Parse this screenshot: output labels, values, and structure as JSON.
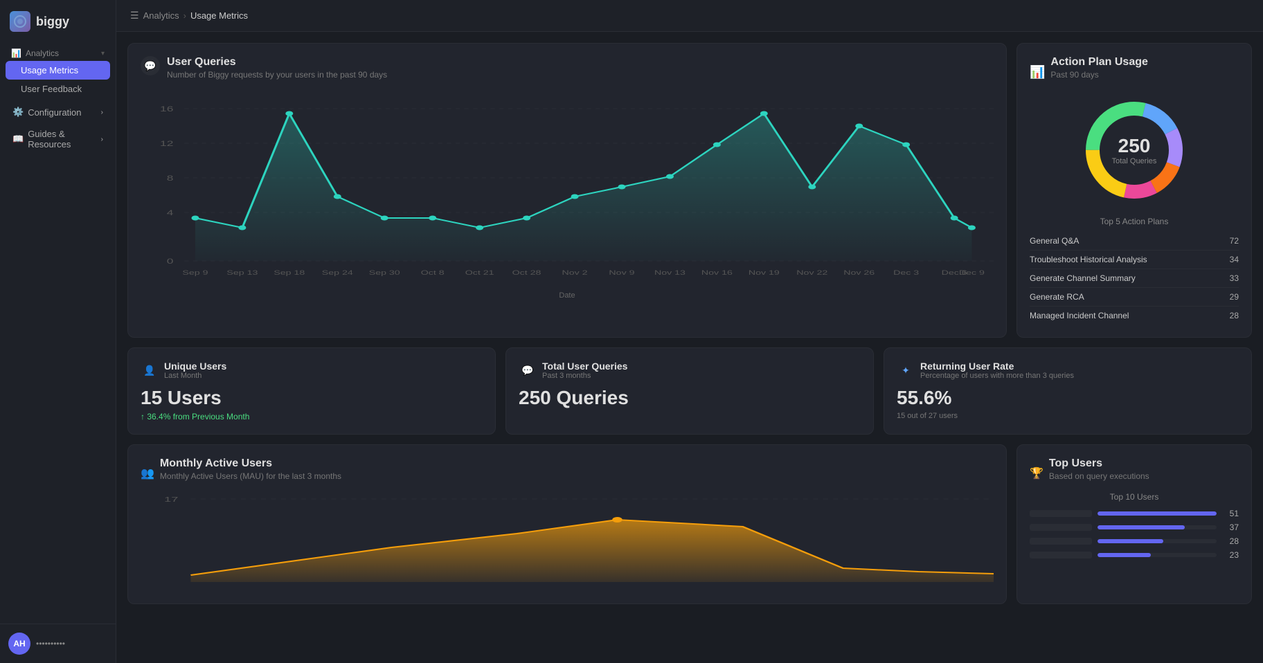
{
  "app": {
    "name": "biggy",
    "logo_emoji": "🔵"
  },
  "sidebar": {
    "analytics_label": "Analytics",
    "usage_metrics_label": "Usage Metrics",
    "user_feedback_label": "User Feedback",
    "configuration_label": "Configuration",
    "guides_label": "Guides & Resources"
  },
  "breadcrumb": {
    "analytics": "Analytics",
    "current": "Usage Metrics"
  },
  "user_queries_chart": {
    "title": "User Queries",
    "subtitle": "Number of Biggy requests by your users in the past 90 days",
    "x_label": "Date",
    "y_max": 16,
    "y_labels": [
      "16",
      "12",
      "8",
      "4",
      "0"
    ],
    "x_labels": [
      "Sep 9",
      "Sep 13",
      "Sep 18",
      "Sep 24",
      "Sep 30",
      "Oct 8",
      "Oct 21",
      "Oct 28",
      "Nov 2",
      "Nov 9",
      "Nov 13",
      "Nov 16",
      "Nov 19",
      "Nov 22",
      "Nov 26",
      "Dec 3",
      "Dec 6",
      "Dec 9"
    ]
  },
  "action_plan": {
    "title": "Action Plan Usage",
    "subtitle": "Past 90 days",
    "total_queries": 250,
    "total_label": "Total Queries",
    "list_title": "Top 5 Action Plans",
    "items": [
      {
        "name": "General Q&A",
        "count": 72
      },
      {
        "name": "Troubleshoot Historical Analysis",
        "count": 34
      },
      {
        "name": "Generate Channel Summary",
        "count": 33
      },
      {
        "name": "Generate RCA",
        "count": 29
      },
      {
        "name": "Managed Incident Channel",
        "count": 28
      }
    ]
  },
  "unique_users": {
    "title": "Unique Users",
    "subtitle": "Last Month",
    "value": "15 Users",
    "change": "↑ 36.4% from Previous Month"
  },
  "total_queries": {
    "title": "Total User Queries",
    "subtitle": "Past 3 months",
    "value": "250 Queries"
  },
  "returning_users": {
    "title": "Returning User Rate",
    "subtitle": "Percentage of users with more than 3 queries",
    "value": "55.6%",
    "detail": "15 out of 27 users"
  },
  "mau": {
    "title": "Monthly Active Users",
    "subtitle": "Monthly Active Users (MAU) for the last 3 months",
    "y_label": "17"
  },
  "top_users": {
    "title": "Top Users",
    "subtitle": "Based on query executions",
    "list_title": "Top 10 Users",
    "items": [
      {
        "count": 51,
        "width_pct": 100
      },
      {
        "count": 37,
        "width_pct": 73
      },
      {
        "count": 28,
        "width_pct": 55
      },
      {
        "count": 23,
        "width_pct": 45
      }
    ]
  },
  "user": {
    "initials": "AH",
    "display_name": "..."
  }
}
